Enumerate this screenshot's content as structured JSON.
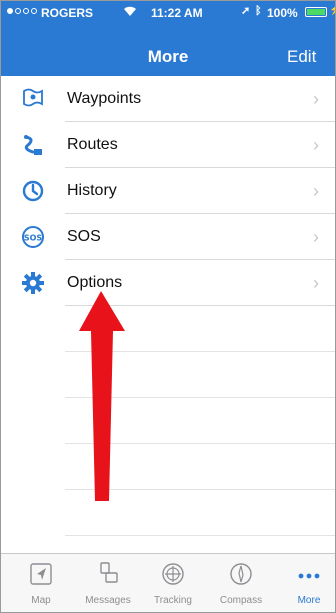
{
  "status_bar": {
    "carrier": "ROGERS",
    "time": "11:22 AM",
    "battery": "100%",
    "battery_level": 1.0
  },
  "nav": {
    "title": "More",
    "edit_label": "Edit"
  },
  "menu": [
    {
      "label": "Waypoints",
      "icon": "waypoint-flag-icon"
    },
    {
      "label": "Routes",
      "icon": "route-icon"
    },
    {
      "label": "History",
      "icon": "history-icon"
    },
    {
      "label": "SOS",
      "icon": "sos-icon"
    },
    {
      "label": "Options",
      "icon": "gear-icon"
    }
  ],
  "tabs": [
    {
      "label": "Map",
      "icon": "map-arrow-icon"
    },
    {
      "label": "Messages",
      "icon": "messages-icon"
    },
    {
      "label": "Tracking",
      "icon": "tracking-icon"
    },
    {
      "label": "Compass",
      "icon": "compass-icon"
    },
    {
      "label": "More",
      "icon": "more-dots-icon",
      "active": true
    }
  ],
  "colors": {
    "header": "#2a79d2",
    "accent": "#2a79d2",
    "annotation_arrow": "#e8131a"
  }
}
